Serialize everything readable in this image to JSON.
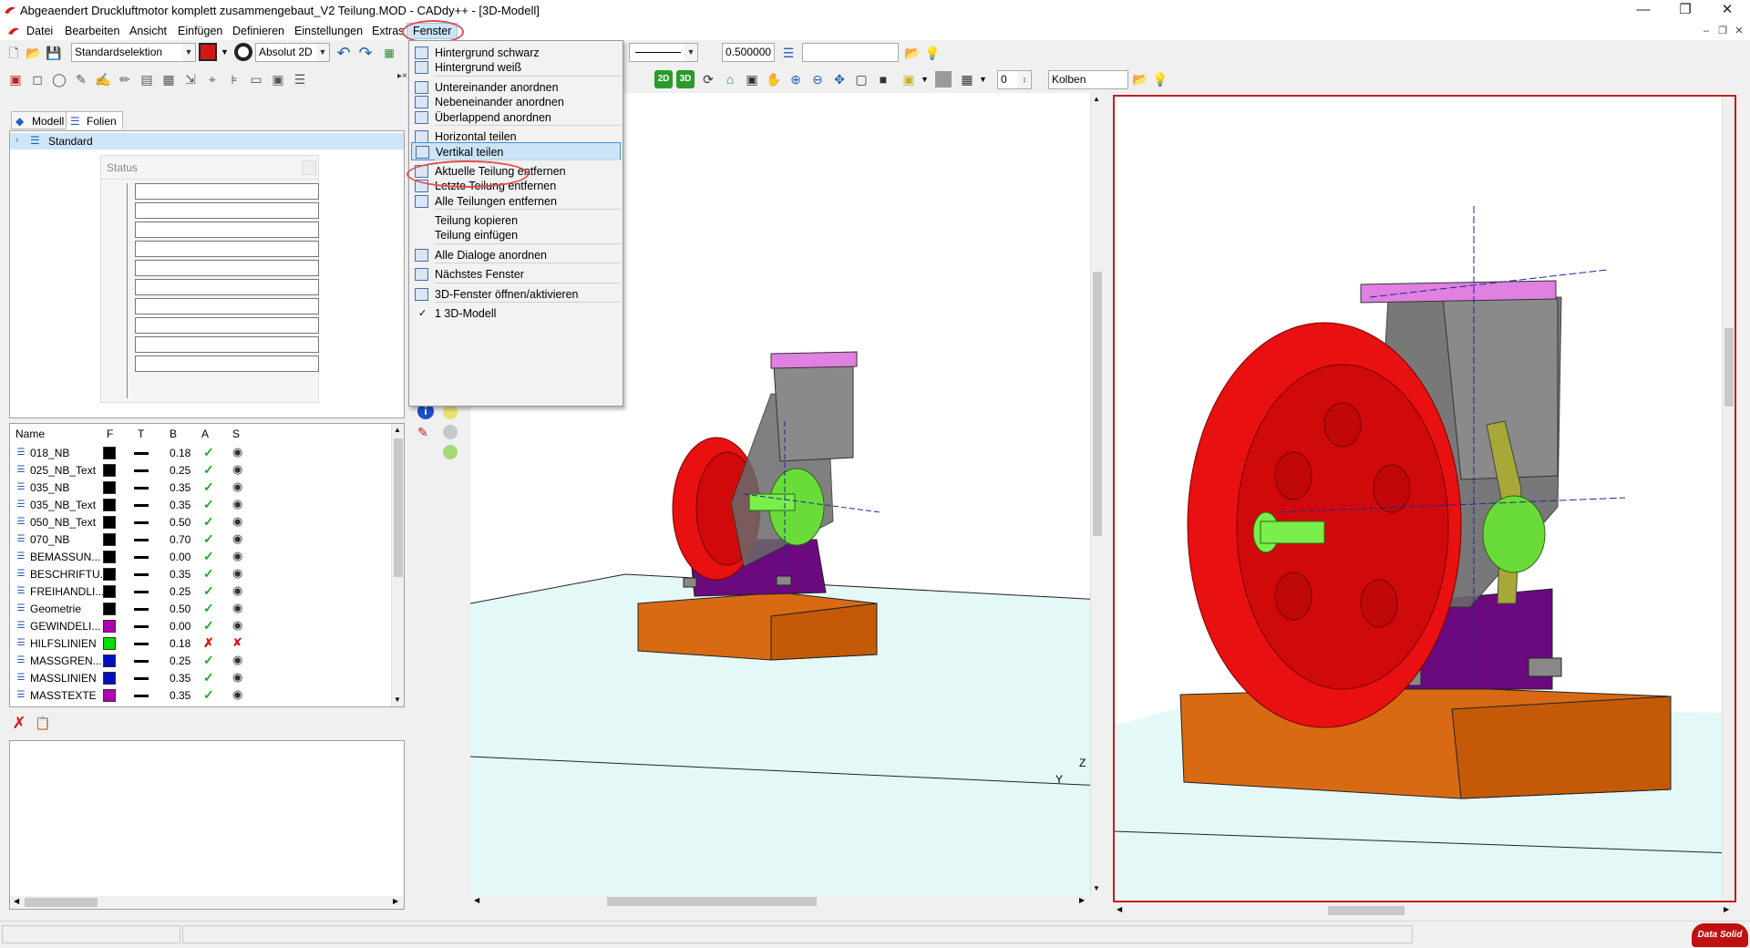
{
  "window": {
    "title": "Abgeaendert Druckluftmotor komplett zusammengebaut_V2 Teilung.MOD  -  CADdy++ - [3D-Modell]"
  },
  "menubar": {
    "items": [
      "Datei",
      "Bearbeiten",
      "Ansicht",
      "Einfügen",
      "Definieren",
      "Einstellungen",
      "Extras",
      "Fenster"
    ],
    "active": "Fenster"
  },
  "toolbar1": {
    "selection_mode": "Standardselektion",
    "coord_mode": "Absolut 2D",
    "line_width": "0.500000",
    "layer_value": ""
  },
  "toolbar2": {
    "count_value": "0",
    "layer_name": "Kolben",
    "view_2d": "2D",
    "view_3d": "3D"
  },
  "fenster_menu": {
    "groups": [
      [
        "Hintergrund schwarz",
        "Hintergrund weiß"
      ],
      [
        "Untereinander anordnen",
        "Nebeneinander anordnen",
        "Überlappend anordnen"
      ],
      [
        "Horizontal teilen",
        "Vertikal teilen"
      ],
      [
        "Aktuelle Teilung entfernen",
        "Letzte Teilung entfernen",
        "Alle Teilungen entfernen"
      ],
      [
        "Teilung kopieren",
        "Teilung einfügen"
      ],
      [
        "Alle Dialoge anordnen"
      ],
      [
        "Nächstes Fenster"
      ],
      [
        "3D-Fenster öffnen/aktivieren"
      ],
      [
        "1 3D-Modell"
      ]
    ],
    "highlighted": "Vertikal teilen",
    "checked": "1 3D-Modell"
  },
  "tree": {
    "tabs": [
      "Modell",
      "Folien"
    ],
    "root": "Standard"
  },
  "status_dialog": {
    "title": "Status"
  },
  "layer_table": {
    "headers": [
      "Name",
      "F",
      "T",
      "B",
      "A",
      "S"
    ],
    "rows": [
      {
        "name": "018_NB",
        "color": "#000000",
        "width": "0.18",
        "active": true,
        "visible": true
      },
      {
        "name": "025_NB_Text",
        "color": "#000000",
        "width": "0.25",
        "active": true,
        "visible": true
      },
      {
        "name": "035_NB",
        "color": "#000000",
        "width": "0.35",
        "active": true,
        "visible": true
      },
      {
        "name": "035_NB_Text",
        "color": "#000000",
        "width": "0.35",
        "active": true,
        "visible": true
      },
      {
        "name": "050_NB_Text",
        "color": "#000000",
        "width": "0.50",
        "active": true,
        "visible": true
      },
      {
        "name": "070_NB",
        "color": "#000000",
        "width": "0.70",
        "active": true,
        "visible": true
      },
      {
        "name": "BEMASSUN...",
        "color": "#000000",
        "width": "0.00",
        "active": true,
        "visible": true
      },
      {
        "name": "BESCHRIFTU...",
        "color": "#000000",
        "width": "0.35",
        "active": true,
        "visible": true
      },
      {
        "name": "FREIHANDLI...",
        "color": "#000000",
        "width": "0.25",
        "active": true,
        "visible": true
      },
      {
        "name": "Geometrie",
        "color": "#000000",
        "width": "0.50",
        "active": true,
        "visible": true
      },
      {
        "name": "GEWINDELI...",
        "color": "#b000b0",
        "width": "0.00",
        "active": true,
        "visible": true
      },
      {
        "name": "HILFSLINIEN",
        "color": "#00e000",
        "width": "0.18",
        "active": false,
        "visible": false
      },
      {
        "name": "MASSGREN...",
        "color": "#0010c0",
        "width": "0.25",
        "active": true,
        "visible": true
      },
      {
        "name": "MASSLINIEN",
        "color": "#0010c0",
        "width": "0.35",
        "active": true,
        "visible": true
      },
      {
        "name": "MASSTEXTE",
        "color": "#b000b0",
        "width": "0.35",
        "active": true,
        "visible": true
      }
    ]
  },
  "viewport": {
    "axis_z": "Z",
    "axis_y": "Y"
  },
  "branding": {
    "logo_text": "Data Solid"
  }
}
